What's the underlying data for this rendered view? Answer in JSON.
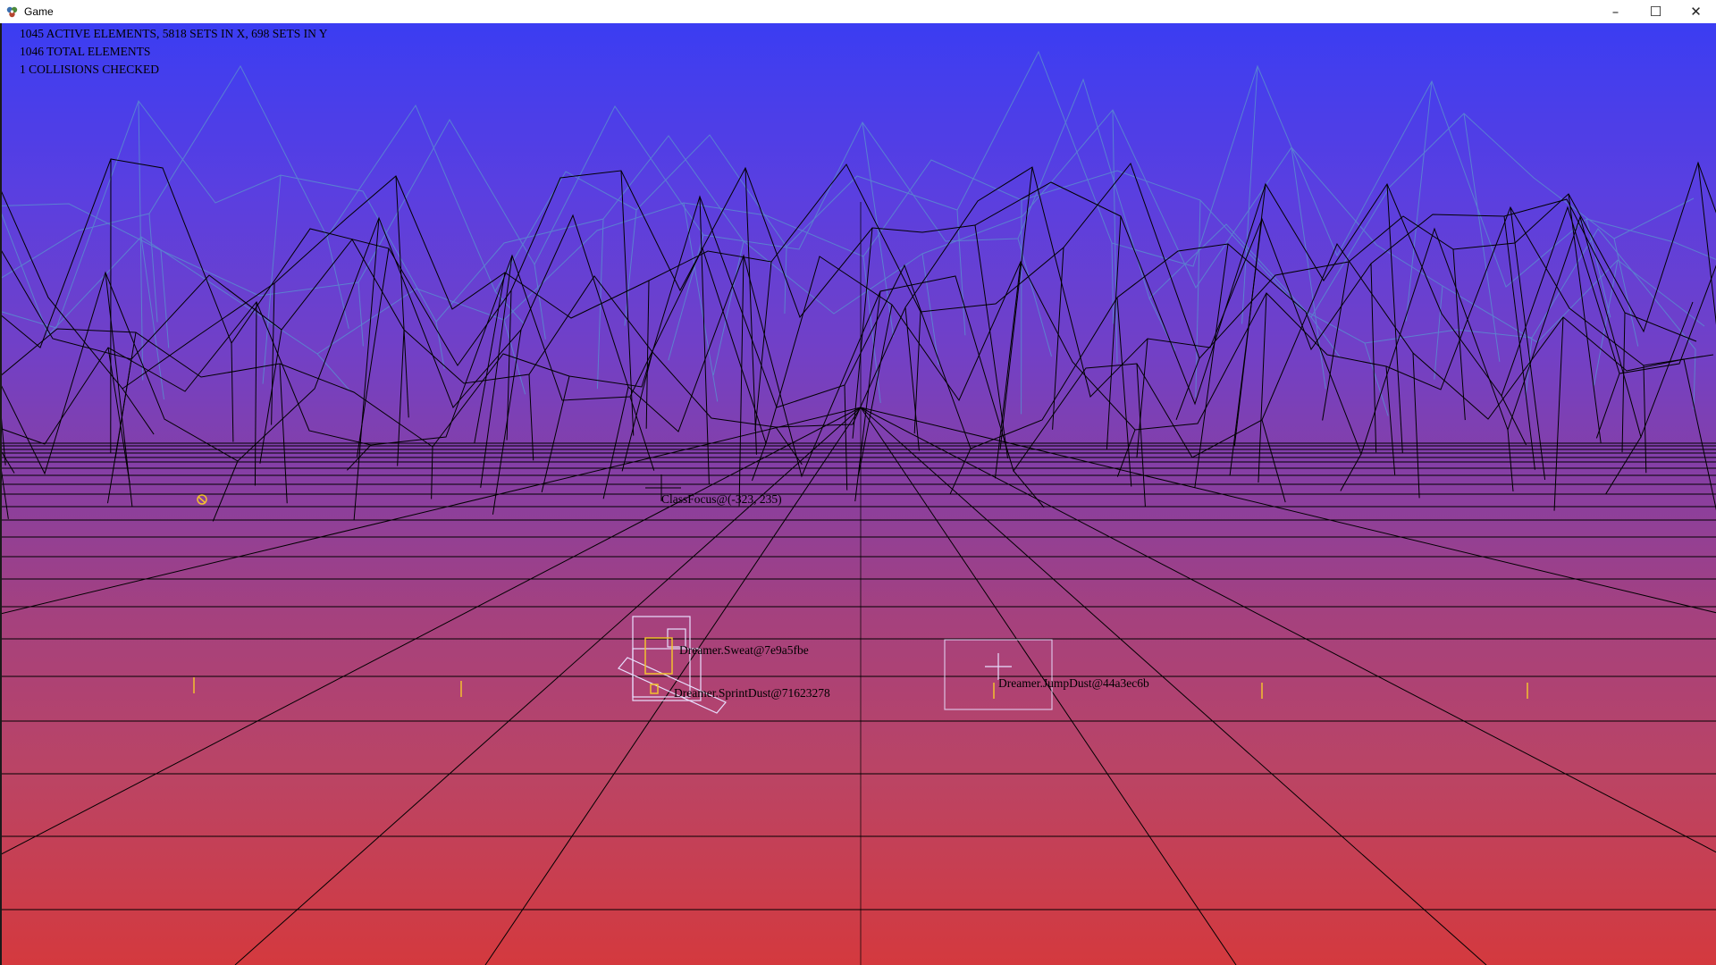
{
  "window": {
    "title": "Game",
    "icon": "game-app-icon",
    "controls": {
      "minimize": "–",
      "maximize": "☐",
      "close": "✕"
    }
  },
  "hud": {
    "line1": "1045 ACTIVE ELEMENTS, 5818 SETS IN X, 698 SETS IN Y",
    "line2": "1046 TOTAL ELEMENTS",
    "line3": "1 COLLISIONS CHECKED"
  },
  "debug_labels": {
    "class_focus": "ClassFocus@(-323, 235)",
    "sweat": "Dreamer.Sweat@7e9a5fbe",
    "sprint_dust": "Dreamer.SprintDust@71623278",
    "jump_dust": "Dreamer.JumpDust@44a3ec6b"
  },
  "colors": {
    "sky_top": "#3b3df2",
    "horizon": "#8a3f9f",
    "floor_bottom": "#d4393e",
    "wireframe": "#000000",
    "wireframe_back": "#5a8ccf",
    "hitbox": "#e8e0ff",
    "marker": "#f2c12e"
  }
}
